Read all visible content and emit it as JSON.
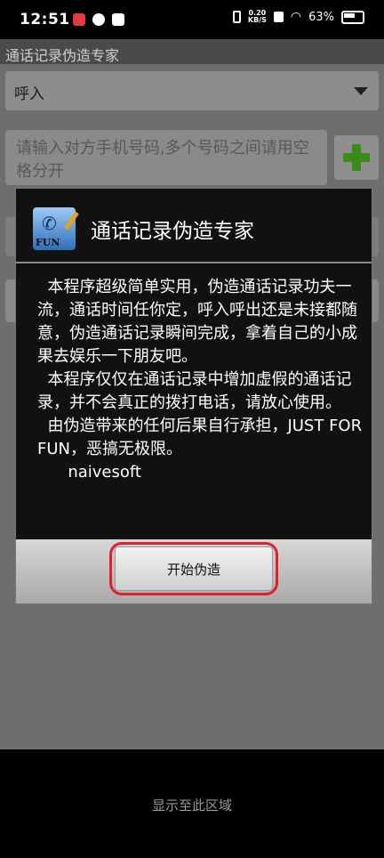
{
  "status_bar": {
    "time": "12:51",
    "net_speed_value": "0.20",
    "net_speed_unit": "KB/S",
    "battery": "63%"
  },
  "app": {
    "title": "通话记录伪造专家",
    "call_type": "呼入",
    "phone_placeholder": "请输入对方手机号码,多个号码之间请用空格分开"
  },
  "dialog": {
    "title": "通话记录伪造专家",
    "paragraphs": [
      "本程序超级简单实用，伪造通话记录功夫一流，通话时间任你定，呼入呼出还是未接都随意，伪造通话记录瞬间完成，拿着自己的小成果去娱乐一下朋友吧。",
      "本程序仅仅在通话记录中增加虚假的通话记录，并不会真正的拨打电话，请放心使用。",
      "由伪造带来的任何后果自行承担，JUST FOR FUN，恶搞无极限。",
      "naivesoft"
    ],
    "start_button": "开始伪造"
  },
  "bottom_bar": {
    "text": "显示至此区域"
  },
  "colors": {
    "highlight_ring": "#e0212a",
    "plus_green": "#3a8a1e"
  }
}
